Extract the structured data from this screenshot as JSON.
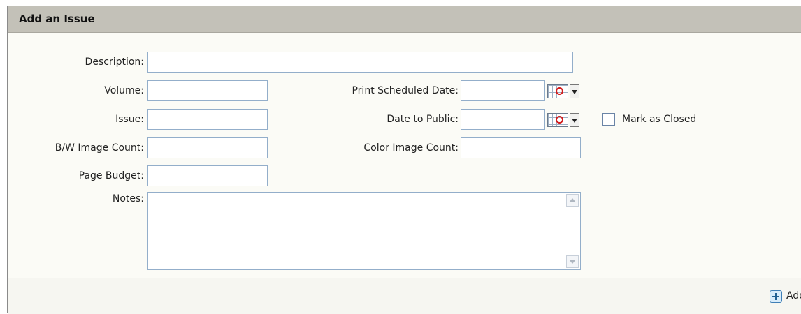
{
  "panel": {
    "title": "Add an Issue"
  },
  "form": {
    "description_label": "Description:",
    "description_value": "",
    "volume_label": "Volume:",
    "volume_value": "",
    "issue_label": "Issue:",
    "issue_value": "",
    "bw_image_count_label": "B/W Image Count:",
    "bw_image_count_value": "",
    "page_budget_label": "Page Budget:",
    "page_budget_value": "",
    "notes_label": "Notes:",
    "notes_value": "",
    "print_scheduled_date_label": "Print Scheduled Date:",
    "print_scheduled_date_value": "",
    "date_to_public_label": "Date to Public:",
    "date_to_public_value": "",
    "color_image_count_label": "Color Image Count:",
    "color_image_count_value": "",
    "mark_as_closed_label": "Mark as Closed",
    "mark_as_closed_checked": false
  },
  "footer": {
    "add_label": "Add"
  },
  "icons": {
    "calendar": "calendar-icon",
    "dropdown": "chevron-down-icon",
    "add": "plus-icon"
  },
  "colors": {
    "header_bg": "#c3c1b8",
    "field_border": "#93aeca",
    "panel_bg": "#fbfbf6"
  }
}
